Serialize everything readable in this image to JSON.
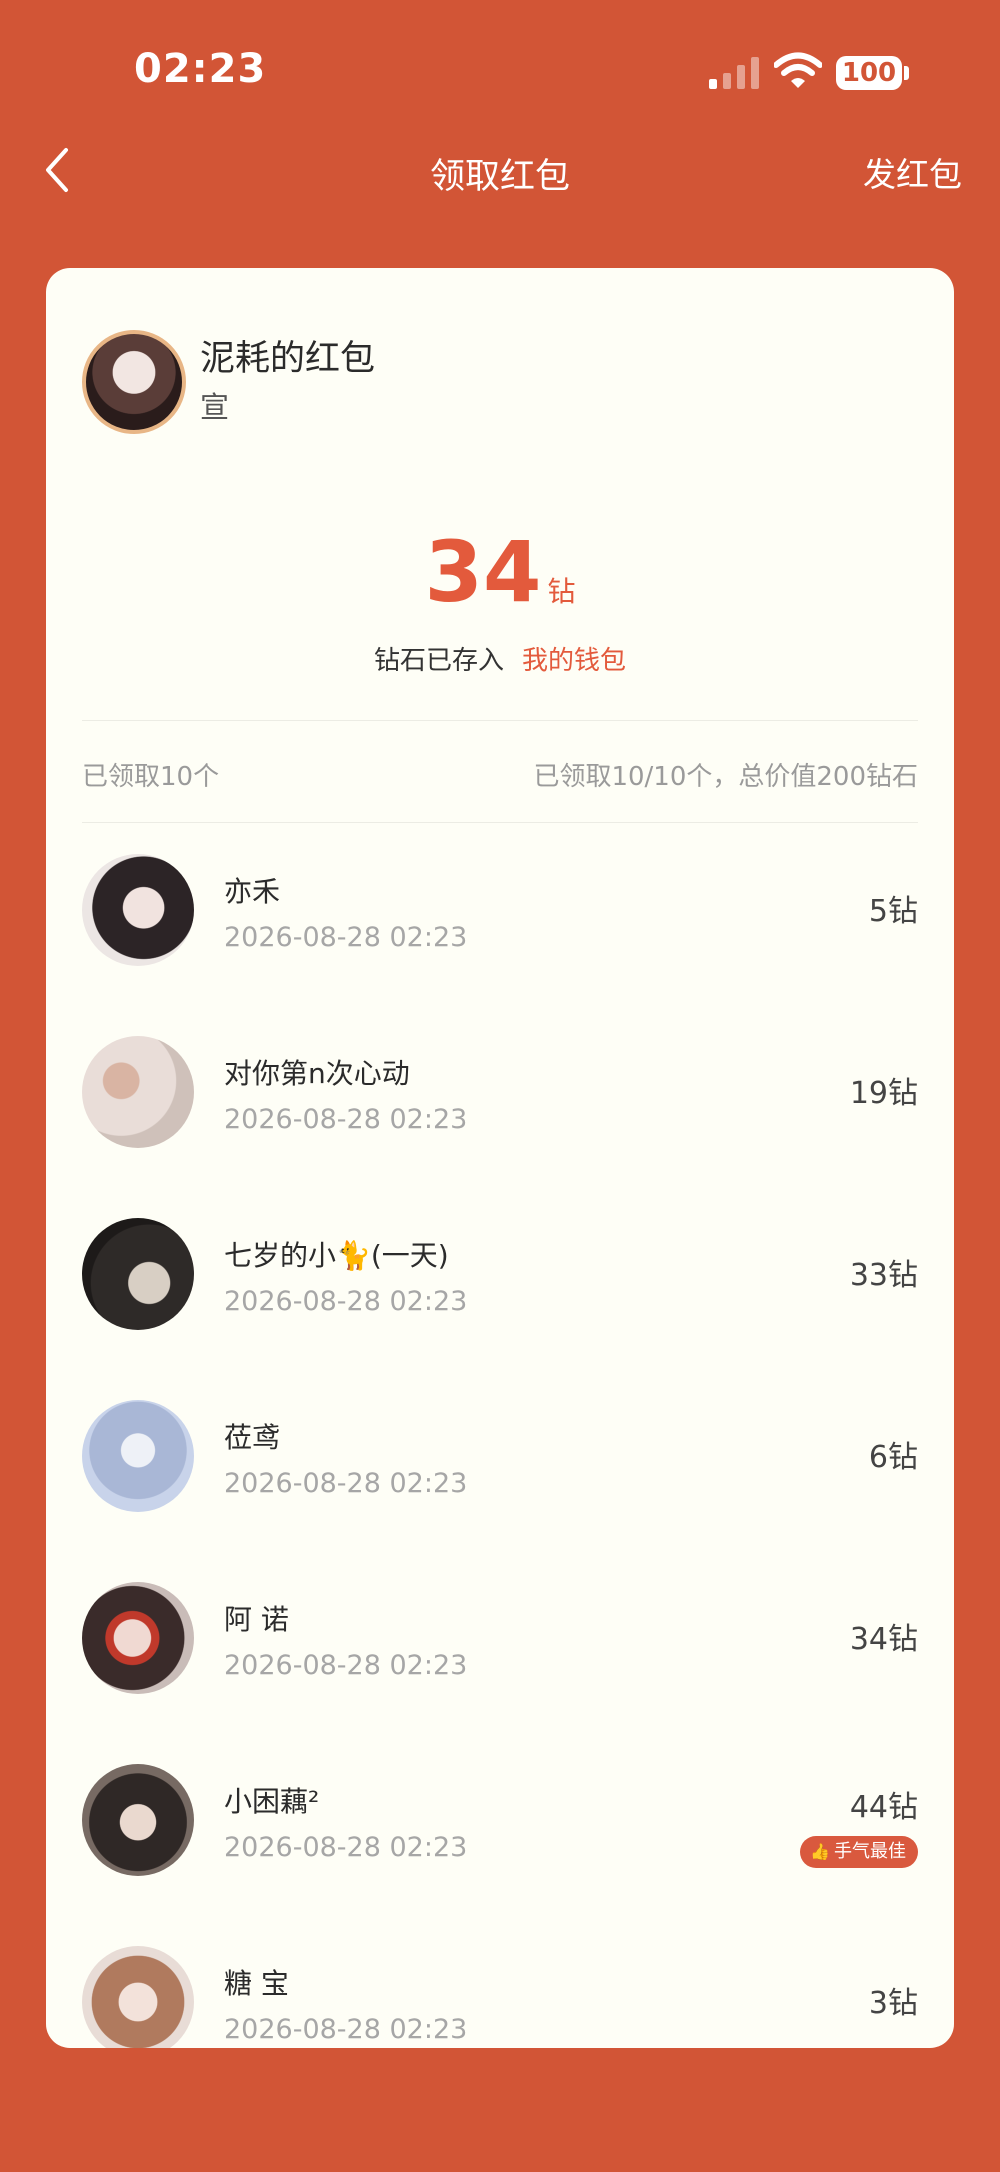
{
  "status_bar": {
    "time": "02:23",
    "battery": "100"
  },
  "nav": {
    "back": "<",
    "title": "领取红包",
    "action": "发红包"
  },
  "packet": {
    "title": "泥耗的红包",
    "subtitle": "宣",
    "amount": "34",
    "unit": "钻",
    "deposit_text": "钻石已存入",
    "wallet_link": "我的钱包"
  },
  "summary": {
    "left": "已领取10个",
    "right": "已领取10/10个，总价值200钻石"
  },
  "records": [
    {
      "name": "亦禾",
      "time": "2026-08-28 02:23",
      "amount": "5钻"
    },
    {
      "name": "对你第n次心动",
      "time": "2026-08-28 02:23",
      "amount": "19钻"
    },
    {
      "name": "七岁的小🐈(一天)",
      "time": "2026-08-28 02:23",
      "amount": "33钻"
    },
    {
      "name": "莅鸢",
      "time": "2026-08-28 02:23",
      "amount": "6钻"
    },
    {
      "name": "阿 诺",
      "time": "2026-08-28 02:23",
      "amount": "34钻"
    },
    {
      "name": "小困藕²",
      "time": "2026-08-28 02:23",
      "amount": "44钻",
      "badge": "手气最佳"
    },
    {
      "name": "糖 宝",
      "time": "2026-08-28 02:23",
      "amount": "3钻"
    }
  ],
  "colors": {
    "background": "#D25536",
    "card": "#FEFEF6",
    "accent": "#E35A3C",
    "badge": "#D9593E"
  }
}
